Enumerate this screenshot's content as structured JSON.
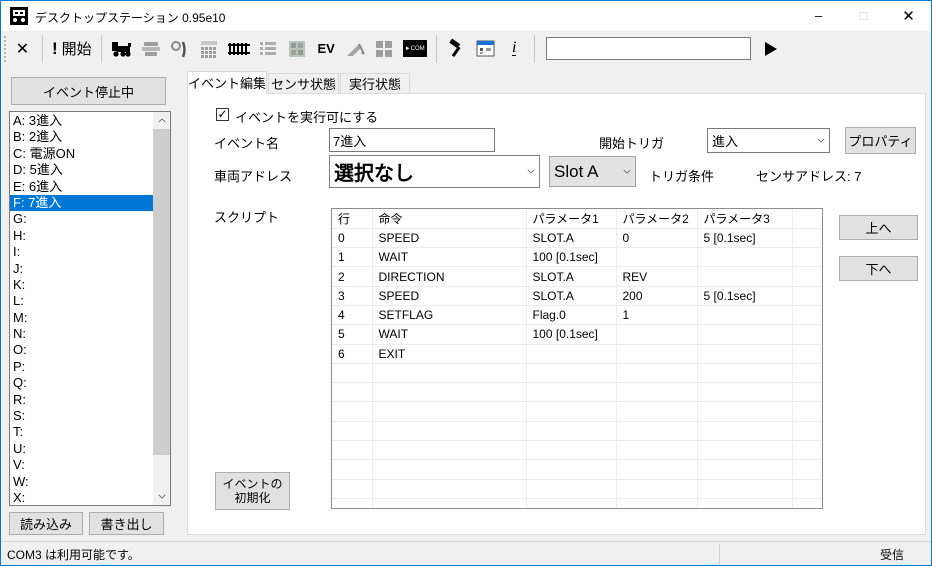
{
  "colors": {
    "accent": "#0078d7",
    "selection": "#0078d7",
    "disabled_icon": "#9d9d9d",
    "icon_black": "#000000"
  },
  "window": {
    "title": "デスクトップステーション 0.95e10",
    "minimize": "–",
    "maximize": "□",
    "close": "✕"
  },
  "toolbar": {
    "stop_glyph": "✕",
    "start_exclamation": "!",
    "start_label": "開始",
    "ev_label": "EV",
    "com_label": "►COM",
    "command_input_value": "",
    "icons": [
      "close-x-icon",
      "start-exclamation-icon",
      "locomotive-icon",
      "platform-icon",
      "turnout-icon",
      "keypad-icon",
      "track-icon",
      "list-icon",
      "layout-icon",
      "ev-icon",
      "crane-icon",
      "blocks-icon",
      "com-icon",
      "hammer-icon",
      "window-icon",
      "info-icon",
      "send-play-icon"
    ]
  },
  "left_panel": {
    "event_status_label": "イベント停止中",
    "events": [
      "A: 3進入",
      "B: 2進入",
      "C: 電源ON",
      "D: 5進入",
      "E: 6進入",
      "F: 7進入",
      "G:",
      "H:",
      "I:",
      "J:",
      "K:",
      "L:",
      "M:",
      "N:",
      "O:",
      "P:",
      "Q:",
      "R:",
      "S:",
      "T:",
      "U:",
      "V:",
      "W:",
      "X:"
    ],
    "selected_index": 5,
    "load_label": "読み込み",
    "export_label": "書き出し"
  },
  "tabs": {
    "event_edit": "イベント編集",
    "sensor_status": "センサ状態",
    "run_status": "実行状態"
  },
  "editor": {
    "enable_checkbox_label": "イベントを実行可にする",
    "enable_checkbox_checked": true,
    "check_glyph": "✓",
    "event_name_label": "イベント名",
    "event_name_value": "7進入",
    "start_trigger_label": "開始トリガ",
    "start_trigger_value": "進入",
    "properties_label": "プロパティ",
    "vehicle_address_label": "車両アドレス",
    "vehicle_address_value": "選択なし",
    "slot_value": "Slot A",
    "trigger_condition_label": "トリガ条件",
    "sensor_address_text": "センサアドレス: 7",
    "script_label": "スクリプト",
    "script_table": {
      "headers": [
        "行",
        "命令",
        "パラメータ1",
        "パラメータ2",
        "パラメータ3"
      ],
      "rows": [
        [
          "0",
          "SPEED",
          "SLOT.A",
          "0",
          "5 [0.1sec]"
        ],
        [
          "1",
          "WAIT",
          "100 [0.1sec]",
          "",
          ""
        ],
        [
          "2",
          "DIRECTION",
          "SLOT.A",
          "REV",
          ""
        ],
        [
          "3",
          "SPEED",
          "SLOT.A",
          "200",
          "5 [0.1sec]"
        ],
        [
          "4",
          "SETFLAG",
          "Flag.0",
          "1",
          ""
        ],
        [
          "5",
          "WAIT",
          "100 [0.1sec]",
          "",
          ""
        ],
        [
          "6",
          "EXIT",
          "",
          "",
          ""
        ]
      ],
      "empty_rows": 8
    },
    "up_label": "上へ",
    "down_label": "下へ",
    "init_label_line1": "イベントの",
    "init_label_line2": "初期化"
  },
  "statusbar": {
    "left_text": "COM3 は利用可能です。",
    "right_text": "受信"
  }
}
